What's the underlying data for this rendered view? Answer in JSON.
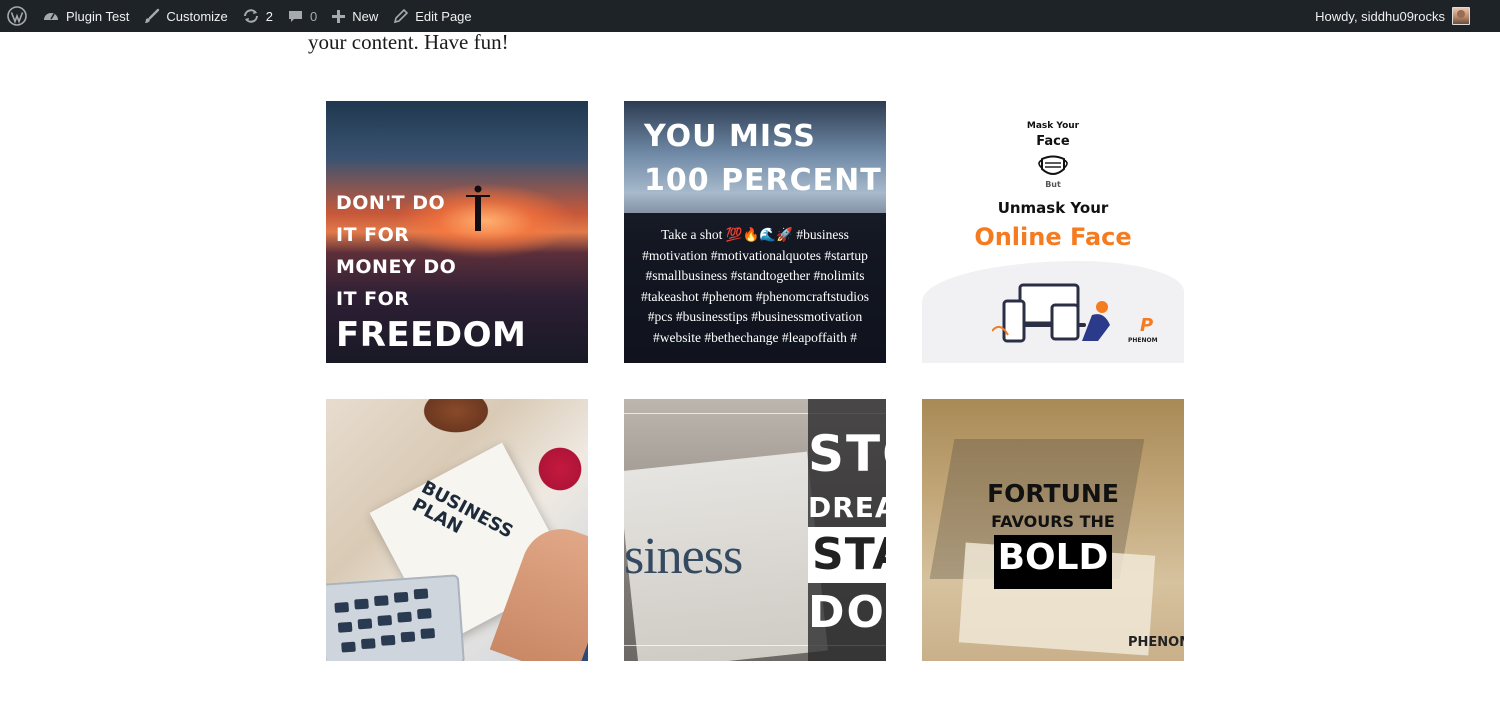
{
  "admin_bar": {
    "site_name": "Plugin Test",
    "customize_label": "Customize",
    "updates_count": "2",
    "comments_count": "0",
    "new_label": "New",
    "edit_label": "Edit Page",
    "greeting": "Howdy, siddhu09rocks",
    "icons": [
      "wordpress-icon",
      "dashboard-icon",
      "brush-icon",
      "updates-icon",
      "comment-icon",
      "plus-icon",
      "pencil-icon"
    ]
  },
  "content": {
    "intro_text": "your content. Have fun!"
  },
  "gallery": {
    "tile1": {
      "lines": [
        "DON'T DO",
        "IT FOR",
        "MONEY DO",
        "IT FOR"
      ],
      "big": "FREEDOM"
    },
    "tile2": {
      "headline_1": "YOU MISS",
      "headline_2": "100 PERCENT",
      "caption": "Take a shot 💯🔥🌊🚀 #business #motivation #motivationalquotes #startup #smallbusiness #standtogether #nolimits #takeashot #phenom #phenomcraftstudios #pcs #businesstips #businessmotivation #website #bethechange #leapoffaith #"
    },
    "tile3": {
      "line1": "Mask Your",
      "line2": "Face",
      "line3": "But",
      "line4": "Unmask Your",
      "line5": "Online Face",
      "brand": "PHENOM",
      "brand_logo": "P",
      "accent_color": "#f47b20"
    },
    "tile4": {
      "handwriting_1": "BUSINESS",
      "handwriting_2": "PLAN"
    },
    "tile5": {
      "news_word": "siness",
      "word1": "STO",
      "word2": "DREAM",
      "word3": "STA",
      "word4": "DOI"
    },
    "tile6": {
      "line1": "FORTUNE",
      "line2": "FAVOURS THE",
      "line3": "BOLD",
      "brand": "PHENOM"
    }
  }
}
